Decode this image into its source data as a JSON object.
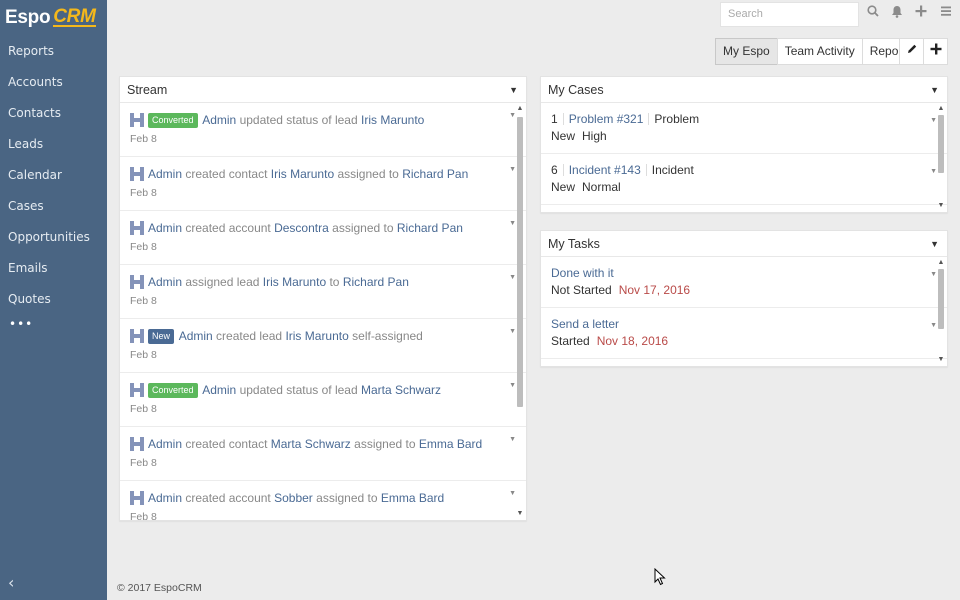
{
  "logo": {
    "part1": "Espo",
    "part2": "CRM"
  },
  "nav": [
    {
      "label": "Reports"
    },
    {
      "label": "Accounts"
    },
    {
      "label": "Contacts"
    },
    {
      "label": "Leads"
    },
    {
      "label": "Calendar"
    },
    {
      "label": "Cases"
    },
    {
      "label": "Opportunities"
    },
    {
      "label": "Emails"
    },
    {
      "label": "Quotes"
    }
  ],
  "nav_more": "•••",
  "sidebar_collapse": "‹",
  "search": {
    "placeholder": "Search"
  },
  "dashboard_tabs": [
    "My Espo",
    "Team Activity",
    "Report"
  ],
  "stream": {
    "title": "Stream",
    "items": [
      {
        "badge": "Converted",
        "actor": "Admin",
        "t1": "updated status of lead",
        "e1": "Iris Marunto",
        "t2": "",
        "e2": "",
        "t3": "",
        "date": "Feb 8"
      },
      {
        "badge": "",
        "actor": "Admin",
        "t1": "created contact",
        "e1": "Iris Marunto",
        "t2": "assigned to",
        "e2": "Richard Pan",
        "t3": "",
        "date": "Feb 8"
      },
      {
        "badge": "",
        "actor": "Admin",
        "t1": "created account",
        "e1": "Descontra",
        "t2": "assigned to",
        "e2": "Richard Pan",
        "t3": "",
        "date": "Feb 8"
      },
      {
        "badge": "",
        "actor": "Admin",
        "t1": "assigned lead",
        "e1": "Iris Marunto",
        "t2": "to",
        "e2": "Richard Pan",
        "t3": "",
        "date": "Feb 8"
      },
      {
        "badge": "New",
        "actor": "Admin",
        "t1": "created lead",
        "e1": "Iris Marunto",
        "t2": "self-assigned",
        "e2": "",
        "t3": "",
        "date": "Feb 8"
      },
      {
        "badge": "Converted",
        "actor": "Admin",
        "t1": "updated status of lead",
        "e1": "Marta Schwarz",
        "t2": "",
        "e2": "",
        "t3": "",
        "date": "Feb 8"
      },
      {
        "badge": "",
        "actor": "Admin",
        "t1": "created contact",
        "e1": "Marta Schwarz",
        "t2": "assigned to",
        "e2": "Emma Bard",
        "t3": "",
        "date": "Feb 8"
      },
      {
        "badge": "",
        "actor": "Admin",
        "t1": "created account",
        "e1": "Sobber",
        "t2": "assigned to",
        "e2": "Emma Bard",
        "t3": "",
        "date": "Feb 8"
      }
    ]
  },
  "cases": {
    "title": "My Cases",
    "items": [
      {
        "number": "1",
        "name": "Problem #321",
        "type": "Problem",
        "status": "New",
        "priority": "High"
      },
      {
        "number": "6",
        "name": "Incident #143",
        "type": "Incident",
        "status": "New",
        "priority": "Normal"
      }
    ]
  },
  "tasks": {
    "title": "My Tasks",
    "items": [
      {
        "name": "Done with it",
        "status": "Not Started",
        "date": "Nov 17, 2016"
      },
      {
        "name": "Send a letter",
        "status": "Started",
        "date": "Nov 18, 2016"
      }
    ]
  },
  "footer": "© 2017 EspoCRM",
  "colors": {
    "sidebar": "#4a6583",
    "link": "#4a6a94",
    "badge_converted": "#5cb85c",
    "badge_new": "#4a6a94",
    "date_red": "#b94a48"
  },
  "icons": [
    "search-icon",
    "bell-icon",
    "plus-icon",
    "menu-icon",
    "pencil-icon",
    "add-dashlet-icon"
  ]
}
